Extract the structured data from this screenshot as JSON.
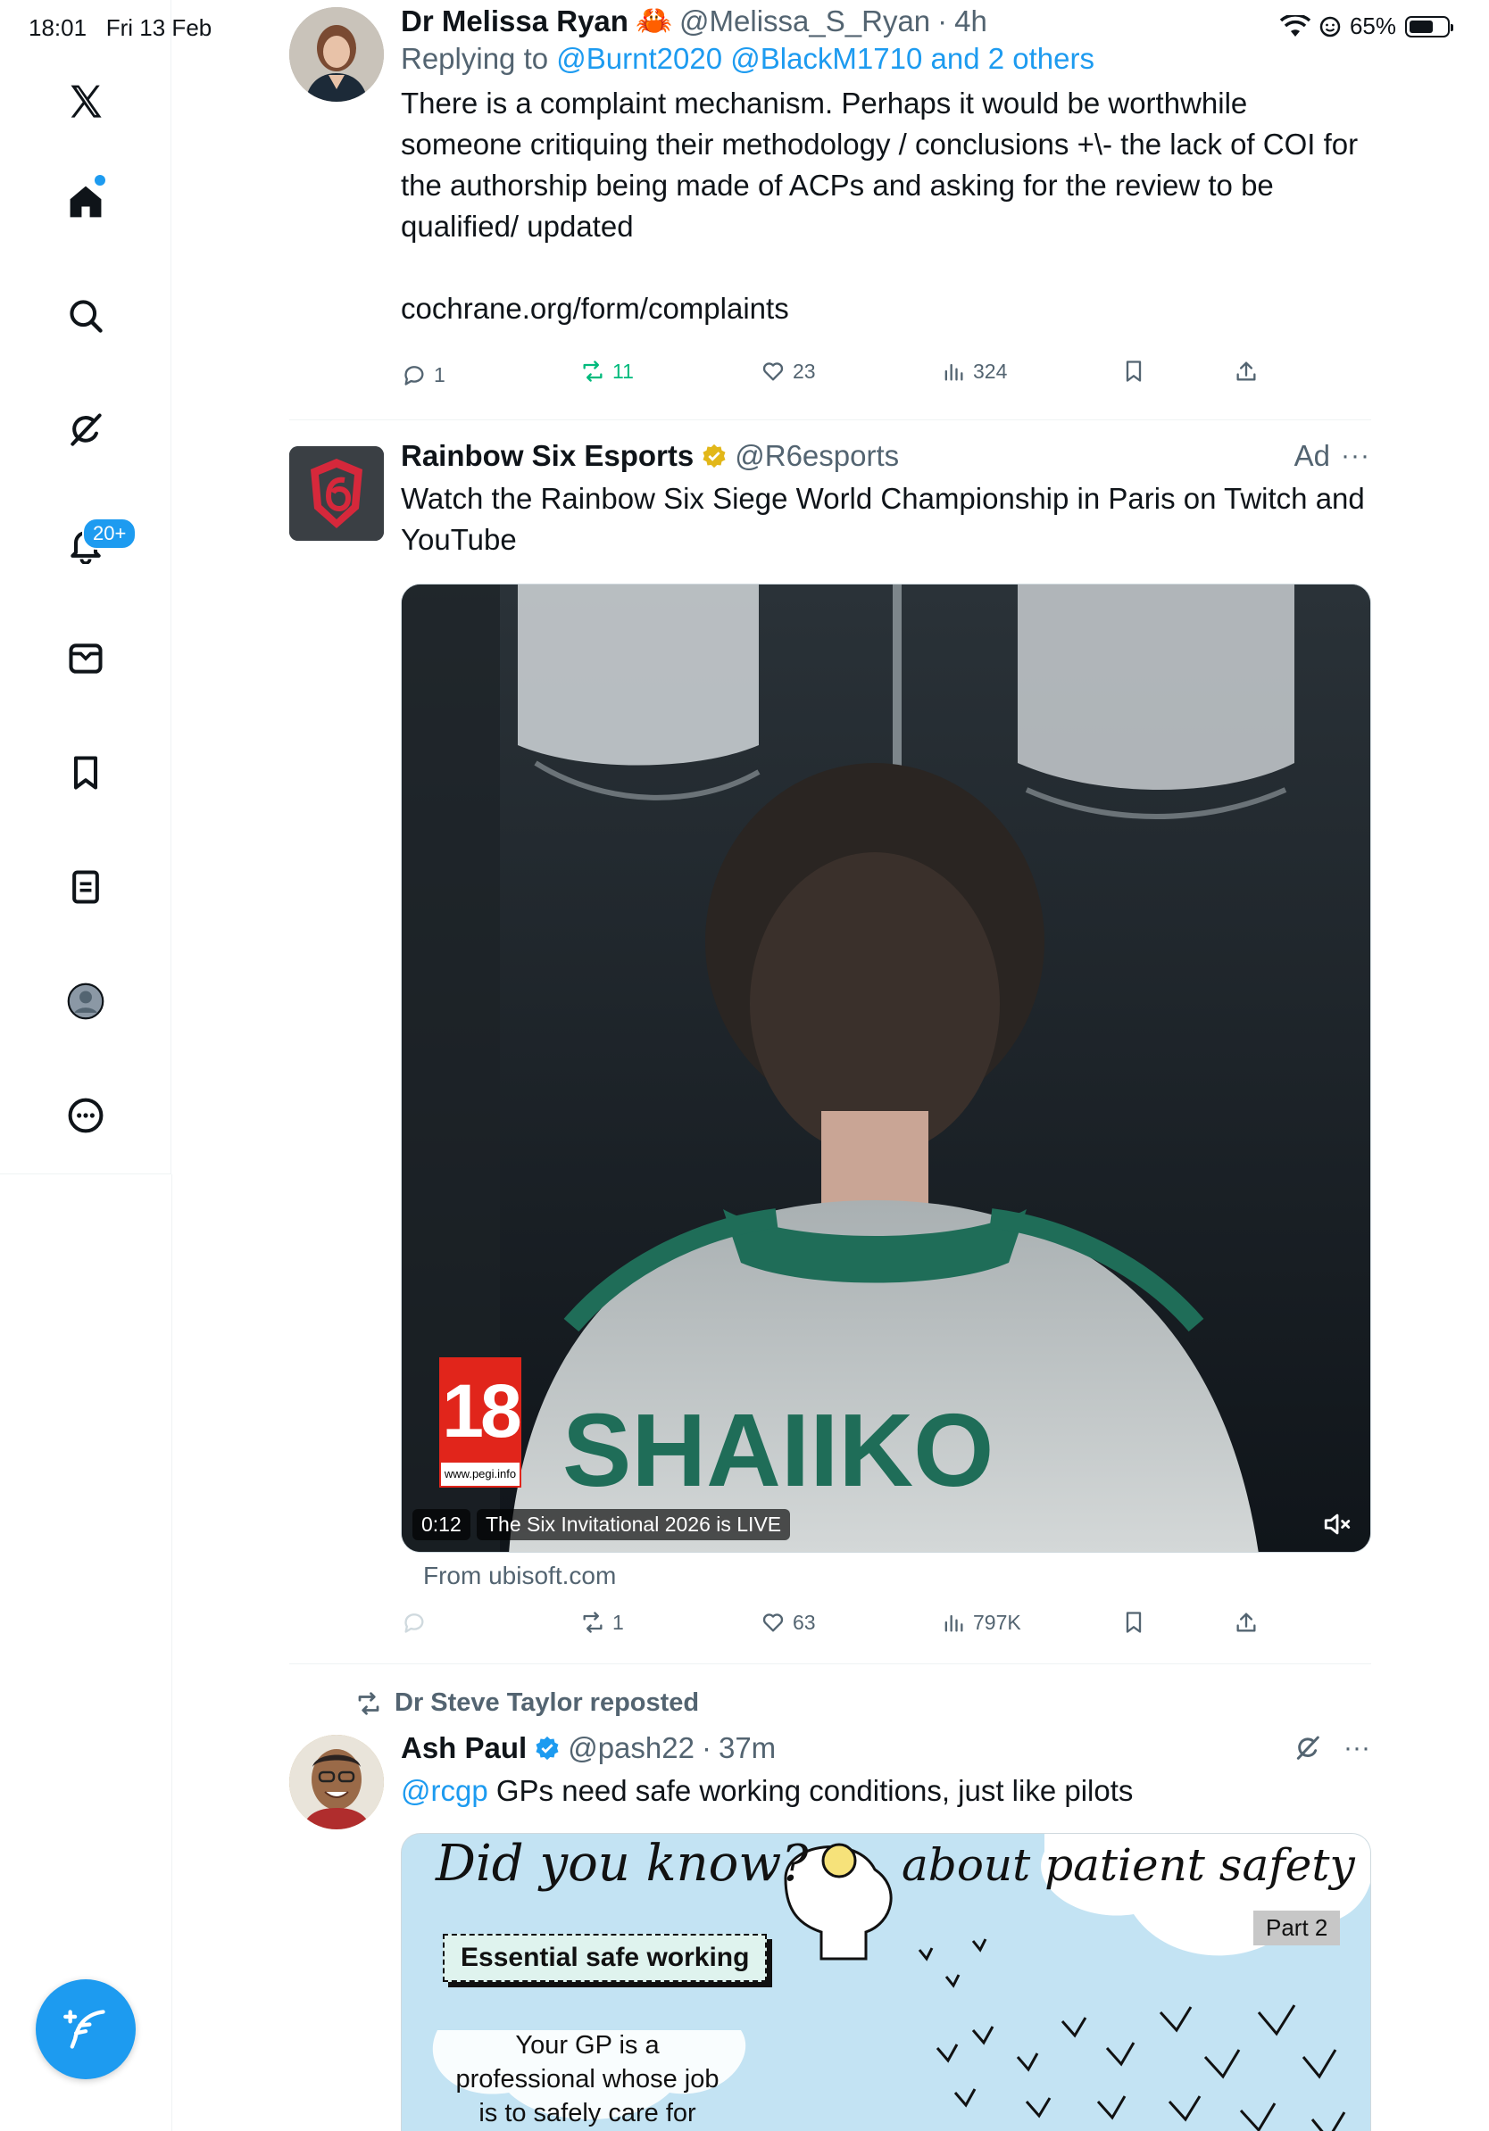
{
  "status_bar": {
    "time": "18:01",
    "date": "Fri 13 Feb",
    "battery": "65%",
    "battery_level": 0.65
  },
  "sidebar": {
    "items": [
      {
        "name": "x-logo-icon"
      },
      {
        "name": "home-icon"
      },
      {
        "name": "search-icon"
      },
      {
        "name": "grok-icon"
      },
      {
        "name": "notifications-icon"
      },
      {
        "name": "messages-icon"
      },
      {
        "name": "bookmarks-icon"
      },
      {
        "name": "lists-icon"
      },
      {
        "name": "profile-icon"
      },
      {
        "name": "more-icon"
      }
    ],
    "notifications_badge": "20+",
    "compose_icon": "compose-icon"
  },
  "tweets": [
    {
      "name": "Dr Melissa Ryan",
      "emoji": "🦀",
      "handle": "@Melissa_S_Ryan",
      "time": "4h",
      "replying_prefix": "Replying to",
      "replying_to": "@Burnt2020 @BlackM1710 and 2 others",
      "text": "There is a complaint mechanism. Perhaps it would be worthwhile someone critiquing their methodology / conclusions +\\- the lack of COI for the authorship being made of ACPs and asking for the review to be qualified/ updated",
      "link": "cochrane.org/form/complaints",
      "replies": "1",
      "reposts": "11",
      "likes": "23",
      "views": "324"
    },
    {
      "name": "Rainbow Six Esports",
      "handle": "@R6esports",
      "ad": "Ad",
      "text": "Watch the Rainbow Six Siege World Championship in Paris on Twitch and YouTube",
      "video_time": "0:12",
      "video_caption": "The Six Invitational 2026 is LIVE",
      "jersey_text": "SHAIIKO",
      "rating": "18",
      "rating_url": "www.pegi.info",
      "source": "From ubisoft.com",
      "replies": "",
      "reposts": "1",
      "likes": "63",
      "views": "797K"
    },
    {
      "reposted_by": "Dr Steve Taylor reposted",
      "name": "Ash Paul",
      "handle": "@pash22",
      "time": "37m",
      "mention": "@rcgp",
      "text": "GPs need safe working conditions, just like pilots",
      "image": {
        "heading_left": "Did you know?",
        "heading_right": "about patient safety",
        "part": "Part 2",
        "box": "Essential safe working",
        "caption": "Your GP is a professional whose job is to safely care for their patients"
      }
    }
  ],
  "colors": {
    "accent": "#1d9bf0",
    "repost_active": "#00ba7c",
    "muted": "#536471"
  }
}
